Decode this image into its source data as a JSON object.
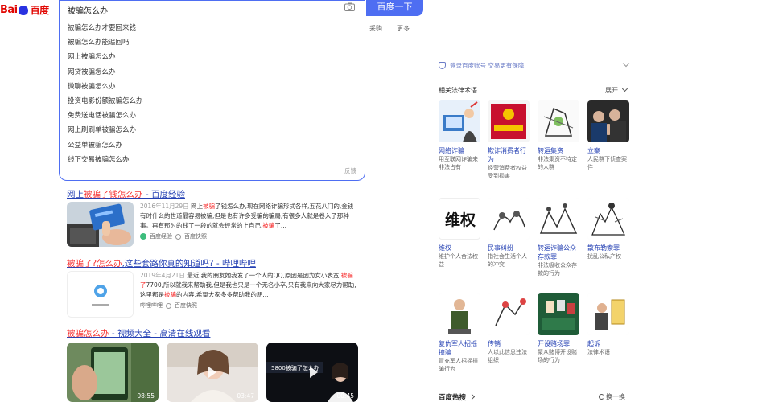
{
  "header": {
    "logo_text": "Bai",
    "logo_cn": "百度",
    "query": "被骗怎么办",
    "search_button": "百度一下",
    "nav_tail": [
      "采购",
      "更多"
    ]
  },
  "suggestions": {
    "items": [
      "被骗怎么办才要回来钱",
      "被骗怎么办能追回吗",
      "网上被骗怎么办",
      "网贷被骗怎么办",
      "微聊被骗怎么办",
      "投资电影份额被骗怎么办",
      "免费送电话被骗怎么办",
      "网上刷刷单被骗怎么办",
      "公益单被骗怎么办",
      "线下交易被骗怎么办"
    ],
    "footer": "反馈"
  },
  "results": [
    {
      "title_pre": "网上",
      "title_hl": "被骗了钱怎么办",
      "title_post": " - 百度经验",
      "date": "2016年11月29日",
      "snippet_a": " 网上",
      "snippet_hl": "被骗",
      "snippet_b": "了钱怎么办,现在网络诈骗形式各样,五花八门的,金钱有时什么的世道最容易被骗,但是也有许多受骗的骗局,有很多人就是卷入了那种事。再有那时的钱了一段的就会经常的上自己,",
      "snippet_hl2": "被骗",
      "snippet_c": "了...",
      "source": "百度经验",
      "kuai": "百度快照"
    },
    {
      "title_pre": "",
      "title_hl": "被骗了?怎么办",
      "title_post": ",这些套路你真的知道吗? - 哔哩哔哩",
      "date": "2019年4月21日",
      "snippet_a": " 最近,我的朋友她我发了一个人的QQ,原因是因为女小表宽,",
      "snippet_hl": "被骗了",
      "snippet_b": "7700,所以就我来帮助我,但是我也只是一个无名小卒,只有我来向大家尽力帮助,这里都是",
      "snippet_hl2": "被骗",
      "snippet_c": "的内容,希望大家多多帮助我的朋...",
      "source": "哔哩哔哩",
      "kuai": "百度快照"
    }
  ],
  "video_section": {
    "title_hl": "被骗怎么办",
    "title_post": " - 视频大全 - 高清在线观看",
    "videos": [
      {
        "duration": "08:55",
        "caption": ""
      },
      {
        "duration": "03:47",
        "caption": ""
      },
      {
        "duration": "00:45",
        "caption": "5800被骗了怎么办"
      }
    ]
  },
  "right": {
    "login_text": "登录百度账号  交易更有保障",
    "law_title": "相关法律术语",
    "expand": "展开",
    "items": [
      {
        "name": "网络诈骗",
        "desc": "用互联网诈骗来非法占有"
      },
      {
        "name": "欺诈消费者行为",
        "desc": "经营消费者权益受到损害"
      },
      {
        "name": "转运集资",
        "desc": "非法集资不特定的人群"
      },
      {
        "name": "立案",
        "desc": "人民群下侦查案件"
      },
      {
        "name": "维权",
        "desc": "维护个人合法权益"
      },
      {
        "name": "民事纠纷",
        "desc": "指社会生活个人的冲突"
      },
      {
        "name": "转运诈骗公众存款罪",
        "desc": "非法吸收公众存款的行为"
      },
      {
        "name": "散布勒索罪",
        "desc": "扰乱公私产权"
      },
      {
        "name": "复仇军人招摇撞骗",
        "desc": "冒充军人招摇撞骗行为"
      },
      {
        "name": "传销",
        "desc": "人以此信息违法组织"
      },
      {
        "name": "开设赌场罪",
        "desc": "聚众赌博开设赌场的行为"
      },
      {
        "name": "起诉",
        "desc": "法律术语"
      }
    ],
    "logo_text": "维权",
    "hot_title": "百度热搜",
    "refresh": "换一换"
  }
}
